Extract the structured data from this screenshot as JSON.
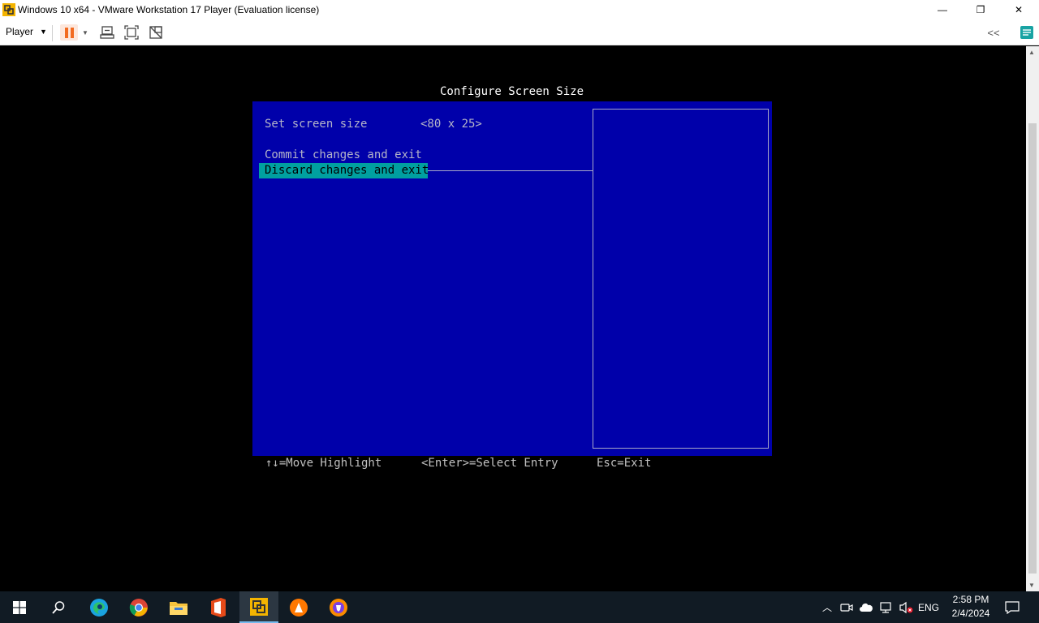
{
  "window": {
    "title": "Windows 10 x64 - VMware Workstation 17 Player (Evaluation license)",
    "minimize_glyph": "—",
    "maximize_glyph": "❐",
    "close_glyph": "✕"
  },
  "toolbar": {
    "player_menu_label": "Player",
    "collapse_glyph": "<<"
  },
  "console": {
    "title": "Configure Screen Size",
    "menu_items": [
      {
        "label": "Set screen size",
        "value": "<80 x 25>"
      },
      {
        "label": "Commit changes and exit"
      },
      {
        "label": "Discard changes and exit",
        "selected": true
      }
    ],
    "footer": {
      "move": "↑↓=Move Highlight",
      "select": "<Enter>=Select Entry",
      "exit": "Esc=Exit"
    },
    "colors": {
      "panel_background": "#0000aa",
      "highlight_background": "#00a0a0"
    }
  },
  "taskbar": {
    "apps": [
      {
        "name": "start-icon"
      },
      {
        "name": "search-icon"
      },
      {
        "name": "edge-icon"
      },
      {
        "name": "chrome-icon"
      },
      {
        "name": "file-explorer-icon"
      },
      {
        "name": "office-icon"
      },
      {
        "name": "vmware-player-icon",
        "active": true
      },
      {
        "name": "avast-icon"
      },
      {
        "name": "brave-icon"
      }
    ],
    "tray": {
      "language": "ENG",
      "time": "2:58 PM",
      "date": "2/4/2024"
    }
  }
}
